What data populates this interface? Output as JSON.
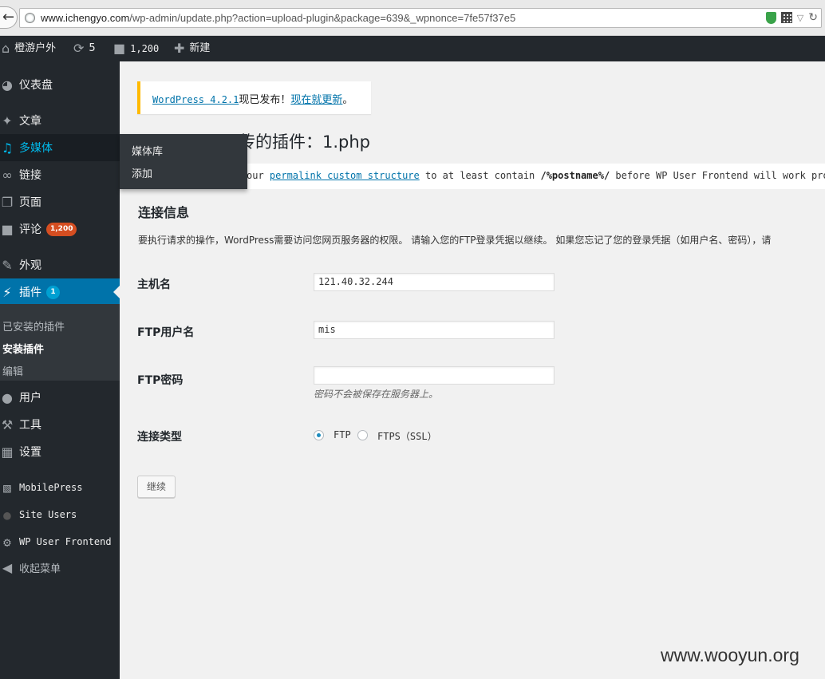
{
  "browser": {
    "url_host": "www.ichengyo.com",
    "url_path": "/wp-admin/update.php?action=upload-plugin&package=639&_wpnonce=7fe57f37e5"
  },
  "adminbar": {
    "site_name": "橙游户外",
    "updates_count": "5",
    "comments_count": "1,200",
    "new_label": "新建"
  },
  "sidebar": {
    "dashboard": "仪表盘",
    "posts": "文章",
    "media": "多媒体",
    "links": "链接",
    "pages": "页面",
    "comments": "评论",
    "comments_badge": "1,200",
    "appearance": "外观",
    "plugins": "插件",
    "plugins_badge": "1",
    "plugins_submenu": [
      "已安装的插件",
      "安装插件",
      "编辑"
    ],
    "users": "用户",
    "tools": "工具",
    "settings": "设置",
    "mobilepress": "MobilePress",
    "site_users": "Site Users",
    "wp_user_frontend": "WP User Frontend",
    "collapse": "收起菜单"
  },
  "flyout": {
    "items": [
      "媒体库",
      "添加"
    ]
  },
  "notice": {
    "version_link": "WordPress 4.2.1",
    "text_mid": "现已发布！",
    "update_link": "现在就更新",
    "text_end": "。"
  },
  "page_title": "传的插件：1.php",
  "error": {
    "prefix": "our ",
    "link": "permalink custom structure",
    "mid": " to at least contain ",
    "bold": "/%postname%/",
    "suffix": " before WP User Frontend will work prop"
  },
  "connection": {
    "title": "连接信息",
    "description": "要执行请求的操作，WordPress需要访问您网页服务器的权限。 请输入您的FTP登录凭据以继续。 如果您忘记了您的登录凭据（如用户名、密码），请",
    "hostname_label": "主机名",
    "hostname_value": "121.40.32.244",
    "username_label": "FTP用户名",
    "username_value": "mis",
    "password_label": "FTP密码",
    "password_value": "",
    "password_hint": "密码不会被保存在服务器上。",
    "type_label": "连接类型",
    "type_options": [
      "FTP",
      "FTPS（SSL）"
    ],
    "submit_label": "继续"
  },
  "watermark": "www.wooyun.org"
}
